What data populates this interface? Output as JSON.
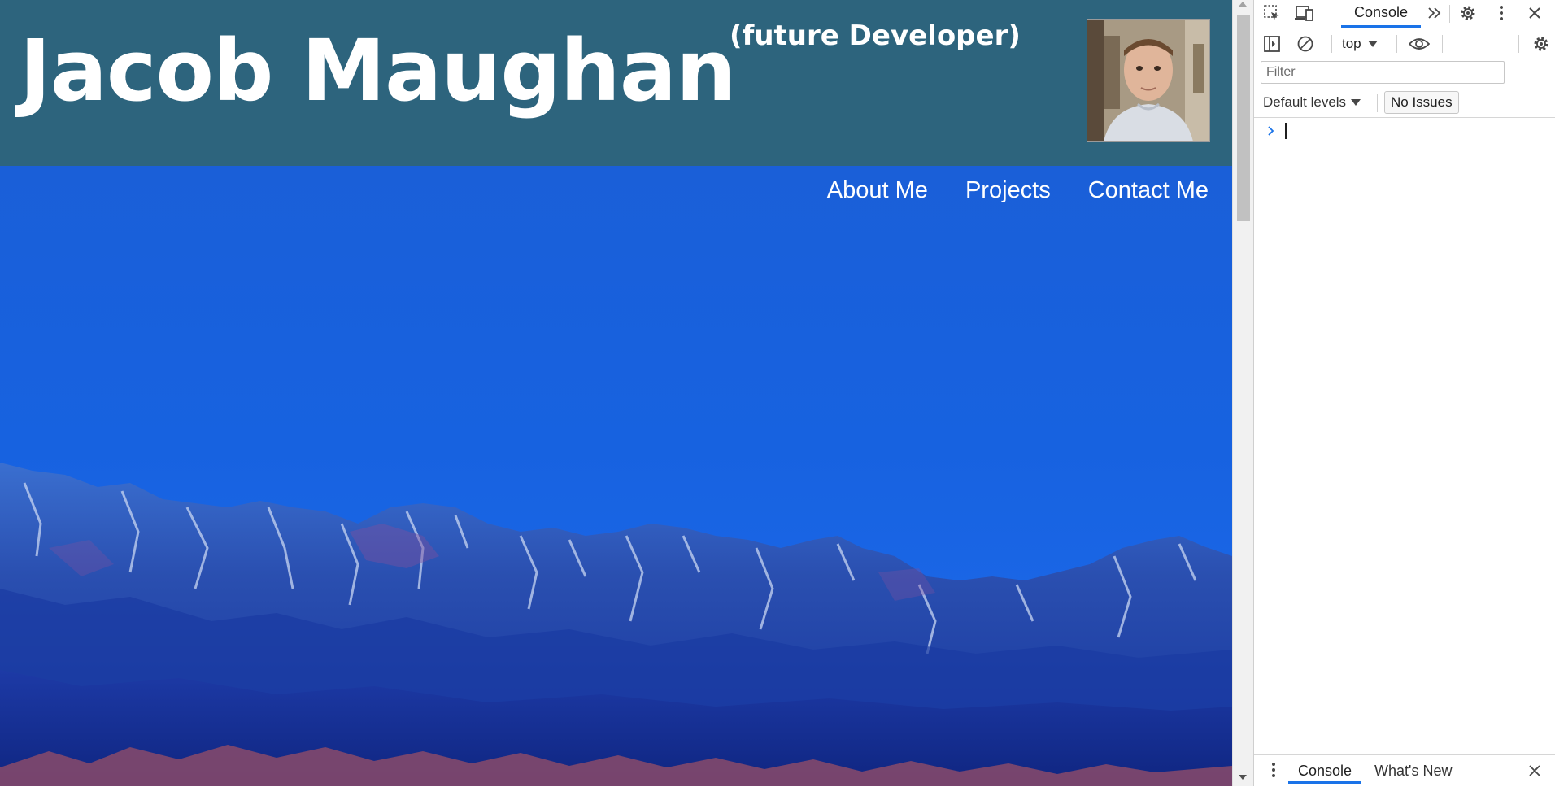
{
  "site": {
    "name": "Jacob Maughan",
    "subtitle": "(future Developer)",
    "nav": [
      "About Me",
      "Projects",
      "Contact Me"
    ],
    "colors": {
      "header_bg": "#2d647d",
      "sky": "#1a5fd6",
      "text": "#ffffff"
    }
  },
  "devtools": {
    "top_icons": [
      "inspect-element-icon",
      "device-toolbar-icon"
    ],
    "active_tab": "Console",
    "more_tabs_icon": "double-chevron-right-icon",
    "toolbar": {
      "context": "top",
      "filter_placeholder": "Filter",
      "levels": "Default levels",
      "issues": "No Issues"
    },
    "drawer": {
      "tabs": [
        "Console",
        "What's New"
      ]
    },
    "accent": "#1a73e8"
  }
}
